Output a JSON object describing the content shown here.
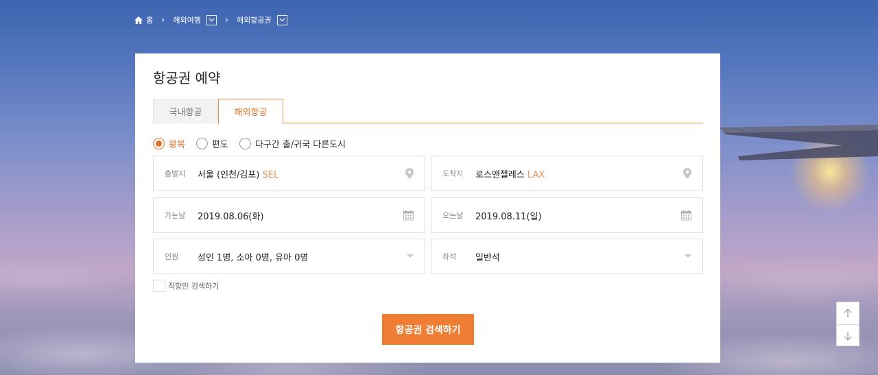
{
  "breadcrumb": {
    "home": "홈",
    "level1": "해외여행",
    "level2": "해외항공권"
  },
  "page_title": "항공권 예약",
  "tabs": [
    {
      "label": "국내항공",
      "active": false
    },
    {
      "label": "해외항공",
      "active": true
    }
  ],
  "trip_types": [
    {
      "label": "왕복",
      "selected": true
    },
    {
      "label": "편도",
      "selected": false
    },
    {
      "label": "다구간 출/귀국 다른도시",
      "selected": false
    }
  ],
  "fields": {
    "departure": {
      "label": "출발지",
      "value": "서울 (인천/김포)",
      "code": "SEL",
      "icon": "map-pin-icon"
    },
    "arrival": {
      "label": "도착지",
      "value": "로스앤젤레스",
      "code": "LAX",
      "icon": "map-pin-icon"
    },
    "depart_date": {
      "label": "가는날",
      "value": "2019.08.06(화)",
      "icon": "calendar-icon"
    },
    "return_date": {
      "label": "오는날",
      "value": "2019.08.11(일)",
      "icon": "calendar-icon"
    },
    "passengers": {
      "label": "인원",
      "value": "성인 1명, 소아 0명, 유아 0명",
      "icon": "caret-down-icon"
    },
    "seat_class": {
      "label": "좌석",
      "value": "일반석",
      "icon": "caret-down-icon"
    }
  },
  "direct_only": {
    "label": "직항만 검색하기",
    "checked": false
  },
  "search_button": "항공권 검색하기",
  "colors": {
    "accent": "#ef7d34",
    "accent_text": "#e0732b",
    "code_text": "#e0914e"
  }
}
